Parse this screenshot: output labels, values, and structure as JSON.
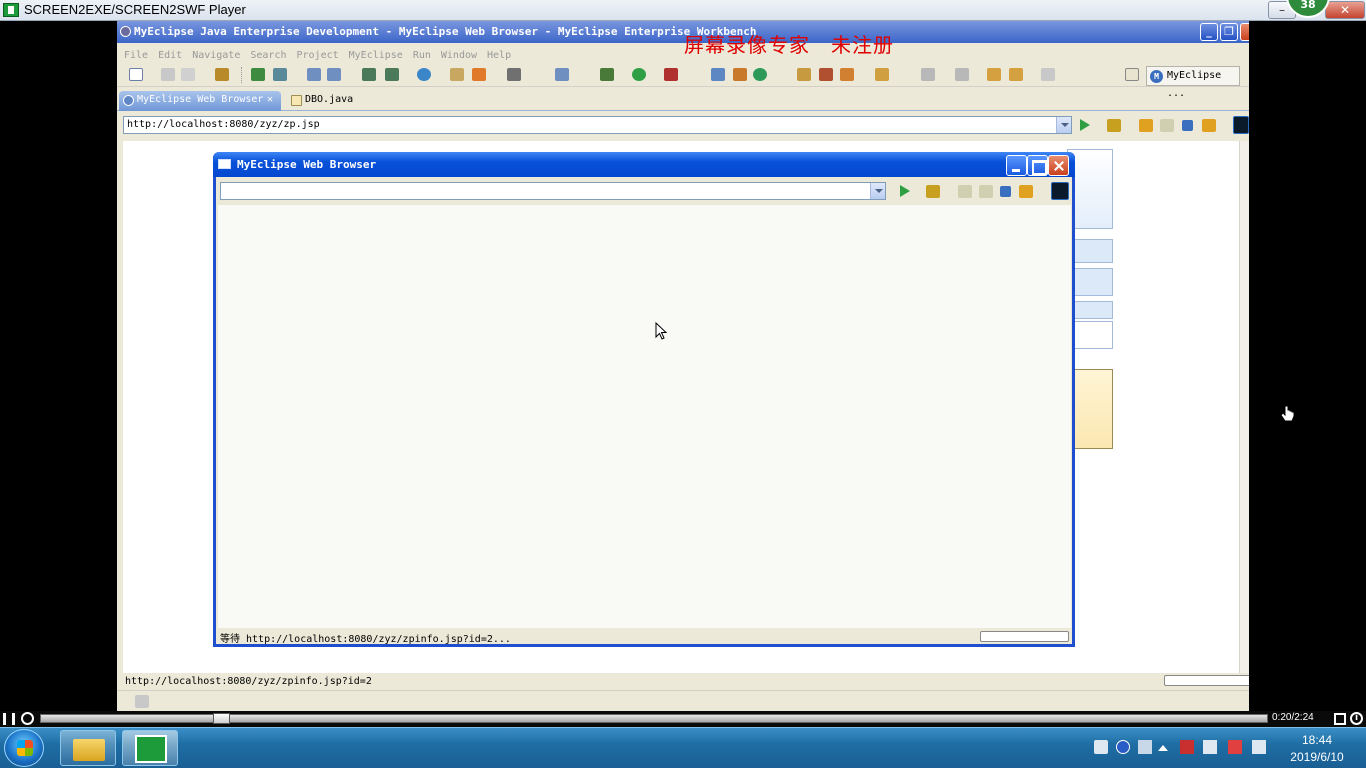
{
  "player": {
    "title": "SCREEN2EXE/SCREEN2SWF Player",
    "badge": "38",
    "close_label": "✕",
    "time": "0:20/2:24",
    "progress_fraction": 0.15
  },
  "eclipse": {
    "title": "MyEclipse Java Enterprise Development - MyEclipse Web Browser - MyEclipse Enterprise Workbench",
    "watermark": "屏幕录像专家　未注册",
    "menu": [
      "File",
      "Edit",
      "Navigate",
      "Search",
      "Project",
      "MyEclipse",
      "Run",
      "Window",
      "Help"
    ],
    "perspective_label": "MyEclipse ...",
    "tabs": [
      {
        "label": "MyEclipse Web Browser",
        "close": "✕"
      },
      {
        "label": "DBO.java"
      }
    ],
    "url": "http://localhost:8080/zyz/zp.jsp",
    "status": "http://localhost:8080/zyz/zpinfo.jsp?id=2"
  },
  "popup": {
    "title": "MyEclipse Web Browser",
    "url": "",
    "status": "等待 http://localhost:8080/zyz/zpinfo.jsp?id=2..."
  },
  "taskbar": {
    "time": "18:44",
    "date": "2019/6/10"
  },
  "colors": {
    "watermark": "#e00000",
    "xp_blue": "#0548d0",
    "taskbar": "#1e6ea5"
  }
}
